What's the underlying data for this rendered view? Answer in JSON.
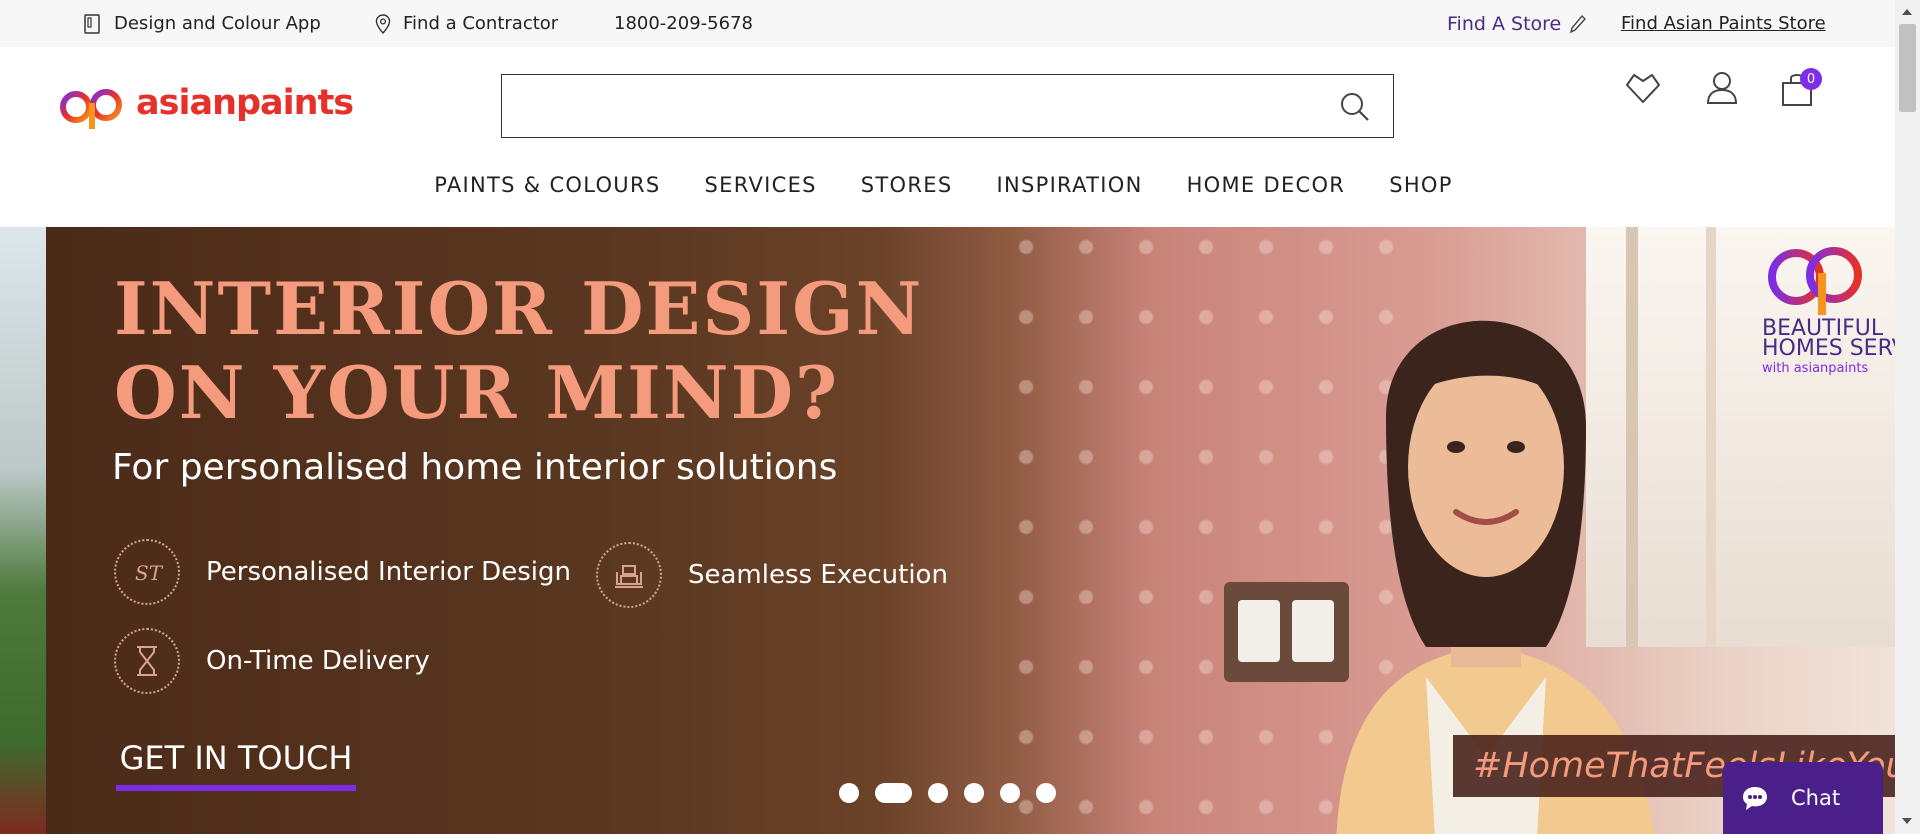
{
  "topbar": {
    "design_app": "Design and Colour App",
    "find_contractor": "Find a Contractor",
    "phone": "1800-209-5678",
    "find_a_store": "Find A Store",
    "find_asian_paints_store": "Find Asian Paints Store"
  },
  "header": {
    "logo_text": "asianpaints",
    "search_placeholder": "",
    "cart_count": "0",
    "icons": [
      "heart-icon",
      "user-icon",
      "cart-icon"
    ]
  },
  "nav": {
    "items": [
      {
        "label": "PAINTS & COLOURS"
      },
      {
        "label": "SERVICES"
      },
      {
        "label": "STORES"
      },
      {
        "label": "INSPIRATION"
      },
      {
        "label": "HOME DECOR"
      },
      {
        "label": "SHOP"
      }
    ]
  },
  "hero": {
    "title_line1": "INTERIOR DESIGN",
    "title_line2": "ON YOUR MIND?",
    "subtitle": "For personalised home interior solutions",
    "features": [
      {
        "label": "Personalised Interior Design",
        "icon": "monogram-icon"
      },
      {
        "label": "Seamless Execution",
        "icon": "sofa-icon"
      },
      {
        "label": "On-Time Delivery",
        "icon": "hourglass-icon"
      }
    ],
    "cta": "GET IN TOUCH",
    "hashtag": "#HomeThatFeelsLikeYou",
    "brand_line1": "BEAUTIFUL",
    "brand_line2": "HOMES SERV",
    "brand_line3": "with asianpaints",
    "carousel": {
      "total": 6,
      "active": 2
    }
  },
  "chat": {
    "label": "Chat"
  },
  "colors": {
    "brand_purple": "#7b2de8",
    "brand_red": "#e6312a",
    "hero_title": "#f49a7d",
    "chat_bg": "#4a1f8a"
  }
}
